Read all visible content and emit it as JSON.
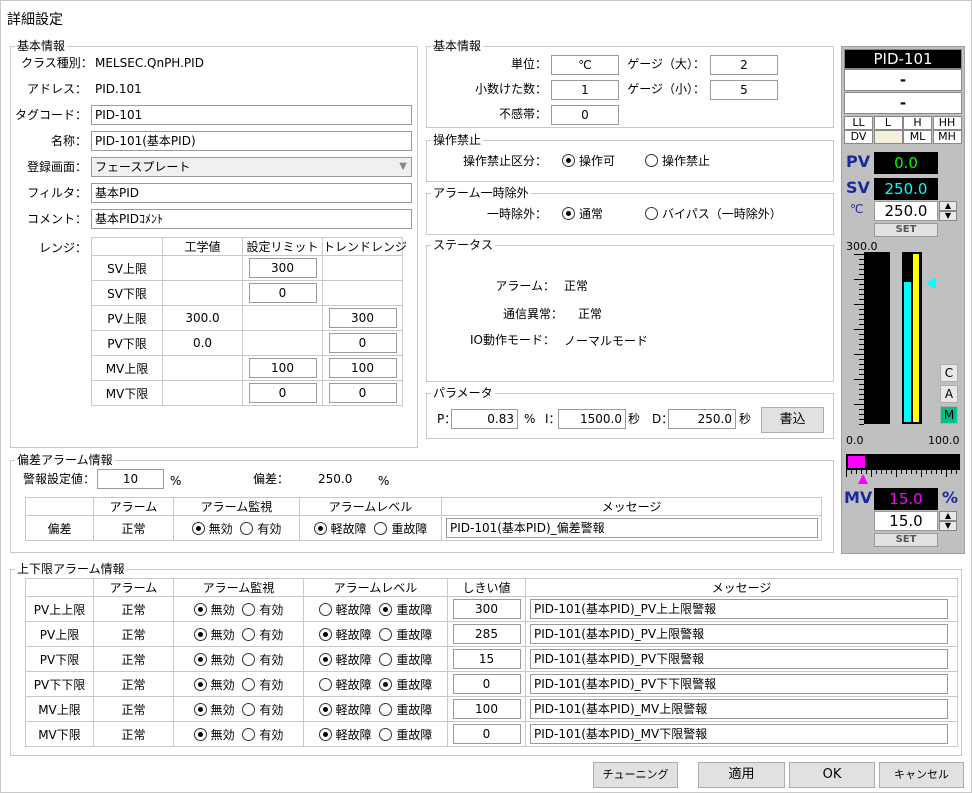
{
  "window": {
    "title": "詳細設定"
  },
  "basic": {
    "group_label": "基本情報",
    "class_label": "クラス種別：",
    "class_value": "MELSEC.QnPH.PID",
    "address_label": "アドレス：",
    "address_value": "PID.101",
    "tag_label": "タグコード：",
    "tag_value": "PID-101",
    "name_label": "名称：",
    "name_value": "PID-101(基本PID)",
    "screen_label": "登録画面：",
    "screen_value": "フェースプレート",
    "filter_label": "フィルタ：",
    "filter_value": "基本PID",
    "comment_label": "コメント：",
    "comment_value": "基本PIDｺﾒﾝﾄ",
    "range_label": "レンジ：",
    "range_headers": [
      "工学値",
      "設定リミット",
      "トレンドレンジ"
    ],
    "range_rows": [
      {
        "label": "SV上限",
        "eng": "",
        "limit": "300",
        "trend": ""
      },
      {
        "label": "SV下限",
        "eng": "",
        "limit": "0",
        "trend": ""
      },
      {
        "label": "PV上限",
        "eng": "300.0",
        "limit": "",
        "trend": "300"
      },
      {
        "label": "PV下限",
        "eng": "0.0",
        "limit": "",
        "trend": "0"
      },
      {
        "label": "MV上限",
        "eng": "",
        "limit": "100",
        "trend": "100"
      },
      {
        "label": "MV下限",
        "eng": "",
        "limit": "0",
        "trend": "0"
      }
    ]
  },
  "basic2": {
    "group_label": "基本情報",
    "unit_label": "単位：",
    "unit_value": "℃",
    "gauge_big_label": "ゲージ（大）：",
    "gauge_big_value": "2",
    "decimals_label": "小数けた数：",
    "decimals_value": "1",
    "gauge_small_label": "ゲージ（小）：",
    "gauge_small_value": "5",
    "deadband_label": "不感帯：",
    "deadband_value": "0"
  },
  "op": {
    "group_label": "操作禁止",
    "field_label": "操作禁止区分：",
    "opt1": "操作可",
    "opt2": "操作禁止"
  },
  "alarm_exclude": {
    "group_label": "アラーム一時除外",
    "field_label": "一時除外：",
    "opt1": "通常",
    "opt2": "バイパス（一時除外）"
  },
  "status": {
    "group_label": "ステータス",
    "alarm_label": "アラーム：",
    "alarm_value": "正常",
    "comm_label": "通信異常：",
    "comm_value": "正常",
    "io_label": "IO動作モード：",
    "io_value": "ノーマルモード"
  },
  "param": {
    "group_label": "パラメータ",
    "p_label": "P：",
    "p_value": "0.83",
    "p_unit": "%",
    "i_label": "I：",
    "i_value": "1500.0",
    "i_unit": "秒",
    "d_label": "D：",
    "d_value": "250.0",
    "d_unit": "秒",
    "write_button": "書込"
  },
  "deviation": {
    "group_label": "偏差アラーム情報",
    "setting_label": "警報設定値：",
    "setting_value": "10",
    "setting_unit": "%",
    "dev_label": "偏差：",
    "dev_value": "250.0",
    "dev_unit": "%",
    "headers": [
      "アラーム",
      "アラーム監視",
      "アラームレベル",
      "メッセージ"
    ],
    "row": {
      "label": "偏差",
      "alarm": "正常",
      "mon_on": "無効",
      "mon_off": "有効",
      "lvl_light": "軽故障",
      "lvl_heavy": "重故障",
      "message": "PID-101(基本PID)_偏差警報"
    }
  },
  "limit": {
    "group_label": "上下限アラーム情報",
    "headers": [
      "アラーム",
      "アラーム監視",
      "アラームレベル",
      "しきい値",
      "メッセージ"
    ],
    "mon_opt1": "無効",
    "mon_opt2": "有効",
    "lvl_opt1": "軽故障",
    "lvl_opt2": "重故障",
    "rows": [
      {
        "label": "PV上上限",
        "alarm": "正常",
        "level": "heavy",
        "threshold": "300",
        "message": "PID-101(基本PID)_PV上上限警報"
      },
      {
        "label": "PV上限",
        "alarm": "正常",
        "level": "light",
        "threshold": "285",
        "message": "PID-101(基本PID)_PV上限警報"
      },
      {
        "label": "PV下限",
        "alarm": "正常",
        "level": "light",
        "threshold": "15",
        "message": "PID-101(基本PID)_PV下限警報"
      },
      {
        "label": "PV下下限",
        "alarm": "正常",
        "level": "heavy",
        "threshold": "0",
        "message": "PID-101(基本PID)_PV下下限警報"
      },
      {
        "label": "MV上限",
        "alarm": "正常",
        "level": "light",
        "threshold": "100",
        "message": "PID-101(基本PID)_MV上限警報"
      },
      {
        "label": "MV下限",
        "alarm": "正常",
        "level": "light",
        "threshold": "0",
        "message": "PID-101(基本PID)_MV下限警報"
      }
    ]
  },
  "faceplate": {
    "tag": "PID-101",
    "line1": "-",
    "line2": "-",
    "alarm_lamps": [
      "LL",
      "L",
      "H",
      "HH",
      "DV",
      "",
      "ML",
      "MH"
    ],
    "pv_label": "PV",
    "pv_value": "0.0",
    "sv_label": "SV",
    "sv_value": "250.0",
    "unit": "℃",
    "sv_input": "250.0",
    "set_label": "SET",
    "bar_top": "300.0",
    "bar_bottom": "0.0",
    "mv_scale_min": "0.0",
    "mv_scale_max": "100.0",
    "mode_buttons": [
      "C",
      "A",
      "M"
    ],
    "mv_label": "MV",
    "mv_value": "15.0",
    "mv_unit": "%",
    "mv_input": "15.0",
    "pv_fill_fraction": 0.0,
    "sv_fill_fraction": 0.833,
    "mv_fill_fraction": 0.15,
    "pv_color": "#00ff00",
    "sv_color": "#00ffff",
    "mv_color": "#ff00ff"
  },
  "footer": {
    "tuning": "チューニング",
    "apply": "適用",
    "ok": "OK",
    "cancel": "キャンセル"
  }
}
